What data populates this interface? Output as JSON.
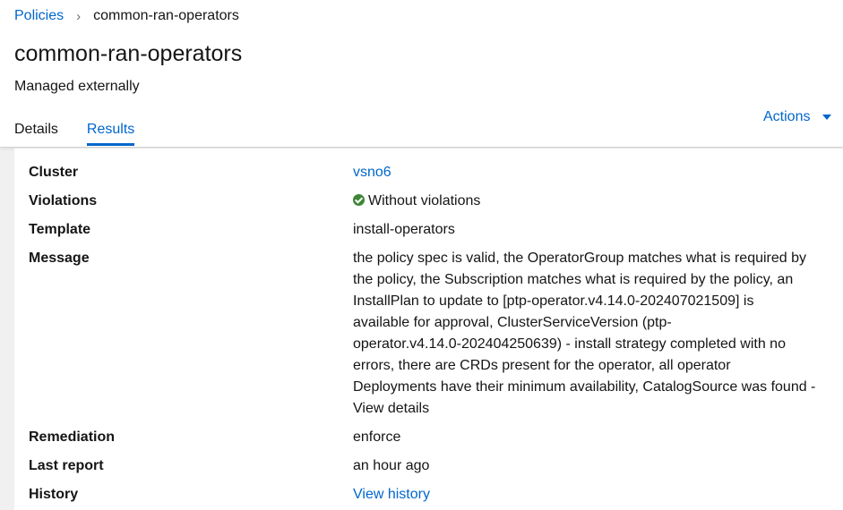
{
  "breadcrumb": {
    "parent": "Policies",
    "current": "common-ran-operators"
  },
  "page": {
    "title": "common-ran-operators",
    "subtitle": "Managed externally"
  },
  "tabs": [
    {
      "label": "Details"
    },
    {
      "label": "Results"
    }
  ],
  "actions": {
    "label": "Actions"
  },
  "colors": {
    "link": "#0066cc",
    "success": "#3e8635"
  },
  "details": {
    "cluster": {
      "label": "Cluster",
      "value": "vsno6"
    },
    "violations": {
      "label": "Violations",
      "value": "Without violations",
      "icon": "check-circle-icon"
    },
    "template": {
      "label": "Template",
      "value": "install-operators"
    },
    "message": {
      "label": "Message",
      "lines": [
        "the policy spec is valid, the OperatorGroup matches what is required by",
        "the policy, the Subscription matches what is required by the policy, an",
        "InstallPlan to update to [ptp-operator.v4.14.0-202407021509] is",
        "available for approval, ClusterServiceVersion (ptp-",
        "operator.v4.14.0-202404250639) - install strategy completed with no",
        "errors, there are CRDs present for the operator, all operator",
        "Deployments have their minimum availability, CatalogSource was found -",
        "View details"
      ]
    },
    "remediation": {
      "label": "Remediation",
      "value": "enforce"
    },
    "last_report": {
      "label": "Last report",
      "value": "an hour ago"
    },
    "history": {
      "label": "History",
      "value": "View history"
    }
  }
}
